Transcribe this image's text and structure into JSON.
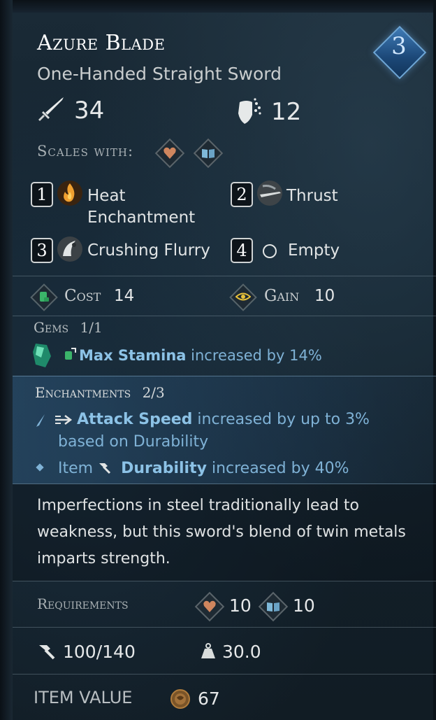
{
  "item": {
    "name": "Azure Blade",
    "type": "One-Handed Straight Sword",
    "tier": "3",
    "attack": "34",
    "block": "12"
  },
  "scales": {
    "label": "Scales with:",
    "icons": [
      "strength-heart-icon",
      "intelligence-book-icon"
    ]
  },
  "abilities": [
    {
      "slot": "1",
      "name": "Heat Enchantment",
      "icon": "fire-icon"
    },
    {
      "slot": "2",
      "name": "Thrust",
      "icon": "thrust-icon"
    },
    {
      "slot": "3",
      "name": "Crushing Flurry",
      "icon": "flurry-icon"
    },
    {
      "slot": "4",
      "name": "Empty",
      "icon": "empty-circle-icon"
    }
  ],
  "cost": {
    "label": "Cost",
    "value": "14"
  },
  "gain": {
    "label": "Gain",
    "value": "10"
  },
  "gems": {
    "header": "Gems",
    "count": "1/1",
    "line": {
      "stat": "Max Stamina",
      "text": "increased by 14%"
    }
  },
  "enchantments": {
    "header": "Enchantments",
    "count": "2/3",
    "line1": {
      "stat": "Attack Speed",
      "text": "increased by up to 3%",
      "text2": "based on Durability"
    },
    "line2": {
      "prefix": "Item",
      "stat": "Durability",
      "text": "increased by 40%"
    }
  },
  "description": "Imperfections in steel traditionally lead to weakness, but this sword's blend of twin metals imparts strength.",
  "requirements": {
    "label": "Requirements",
    "strength": "10",
    "intelligence": "10"
  },
  "durability": "100/140",
  "weight": "30.0",
  "item_value": {
    "label": "ITEM VALUE",
    "value": "67"
  },
  "colors": {
    "accent_blue": "#8cc2e6",
    "tier_blue": "#3f7bb6",
    "background": "#142430"
  }
}
